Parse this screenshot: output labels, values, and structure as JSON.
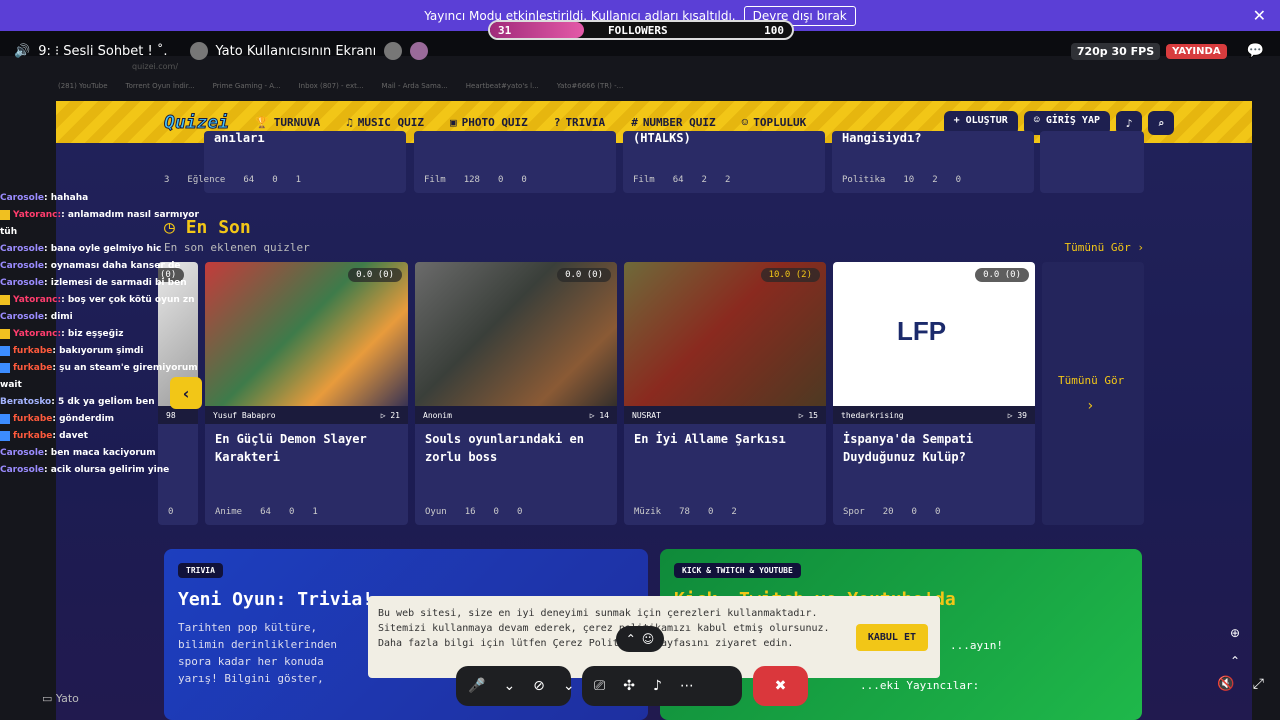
{
  "banner": {
    "text": "Yayıncı Modu etkinleştirildi. Kullanıcı adları kısaltıldı.",
    "disable_button": "Devre dışı bırak",
    "followers": {
      "current": "31",
      "label": "FOLLOWERS",
      "goal": "100",
      "progress_fraction": 0.31
    }
  },
  "topbar": {
    "channel": "9: ⁝ Sesli Sohbet ! ˚.",
    "stream_title": "Yato Kullanıcısının Ekranı",
    "quality": "720p 30 FPS",
    "live_label": "YAYINDA"
  },
  "browser": {
    "url": "quizei.com/",
    "tabs": [
      "(281) YouTube",
      "Torrent Oyun İndir...",
      "Prime Gaming - A...",
      "Inbox (807) - ext...",
      "Mail - Arda Sama...",
      "Heartbeat#yato's l...",
      "Yato#6666 (TR) -..."
    ]
  },
  "site": {
    "logo": "Quizei",
    "nav": [
      "TURNUVA",
      "MUSIC QUIZ",
      "PHOTO QUIZ",
      "TRIVIA",
      "NUMBER QUIZ",
      "TOPLULUK"
    ],
    "create": "+ OLUŞTUR",
    "login": "GİRİŞ YAP",
    "prev_row": [
      {
        "title": "anıları",
        "category": "Eğlence",
        "questions": "64",
        "comments": "0",
        "likes": "1",
        "extra": "3"
      },
      {
        "title": "",
        "category": "Film",
        "questions": "128",
        "comments": "0",
        "likes": "0"
      },
      {
        "title": "(HTALKS)",
        "category": "Film",
        "questions": "64",
        "comments": "2",
        "likes": "2"
      },
      {
        "title": "Hangisiydı?",
        "category": "Politika",
        "questions": "10",
        "comments": "2",
        "likes": "0"
      }
    ],
    "section": {
      "title": "En Son",
      "subtitle": "En son eklenen quizler",
      "see_all": "Tümünü Gör ›",
      "see_all_card": "Tümünü Gör"
    },
    "cards": [
      {
        "rating": "0.0 (0)",
        "author": "Yusuf Babapro",
        "plays": "21",
        "title": "En Güçlü Demon Slayer Karakteri",
        "category": "Anime",
        "questions": "64",
        "comments": "0",
        "likes": "1"
      },
      {
        "rating": "0.0 (0)",
        "author": "Anonim",
        "plays": "14",
        "title": "Souls oyunlarındaki en zorlu boss",
        "category": "Oyun",
        "questions": "16",
        "comments": "0",
        "likes": "0"
      },
      {
        "rating": "10.0 (2)",
        "author": "NUSRAT",
        "plays": "15",
        "title": "En İyi Allame Şarkısı",
        "category": "Müzik",
        "questions": "78",
        "comments": "0",
        "likes": "2"
      },
      {
        "rating": "0.0 (0)",
        "author": "thedarkrising",
        "plays": "39",
        "title": "İspanya'da Sempati Duyduğunuz Kulüp?",
        "category": "Spor",
        "questions": "20",
        "comments": "0",
        "likes": "0"
      }
    ],
    "first_card_left": {
      "rating": "(0)",
      "plays": "98",
      "likes": "0"
    },
    "promo_left": {
      "tag": "TRIVIA",
      "title": "Yeni Oyun: Trivia!",
      "text": "Tarihten pop kültüre, bilimin derinliklerinden spora kadar her konuda yarış! Bilgini göster,"
    },
    "promo_right": {
      "tag": "KICK & TWITCH & YOUTUBE",
      "title": "Kick, Twitch ve Youtube'da",
      "text": "...ayın!",
      "footer": "...eki Yayıncılar:"
    },
    "cookie": {
      "text": "Bu web sitesi, size en iyi deneyimi sunmak için çerezleri kullanmaktadır. Sitemizi kullanmaya devam ederek, çerez politikamızı kabul etmiş olursunuz. Daha fazla bilgi için lütfen Çerez Politikası sayfasını ziyaret edin.",
      "accept": "KABUL ET"
    }
  },
  "chat": [
    {
      "user": "Carosole",
      "msg": ": hahaha",
      "style": "u1",
      "badge": ""
    },
    {
      "user": "Yatoranc:",
      "msg": ": anlamadım nasıl sarmıyor tüh",
      "style": "u2",
      "badge": "y"
    },
    {
      "user": "Carosole",
      "msg": ": bana oyle gelmiyo hic",
      "style": "u1",
      "badge": ""
    },
    {
      "user": "Carosole",
      "msg": ": oynaması daha kanser de",
      "style": "u1",
      "badge": ""
    },
    {
      "user": "Carosole",
      "msg": ": izlemesi de sarmadi bi ben",
      "style": "u1",
      "badge": ""
    },
    {
      "user": "Yatoranc:",
      "msg": ": boş ver çok kötü oyun zn",
      "style": "u2",
      "badge": "y"
    },
    {
      "user": "Carosole",
      "msg": ": dimi",
      "style": "u1",
      "badge": ""
    },
    {
      "user": "Yatoranc:",
      "msg": ": biz eşşeğiz",
      "style": "u2",
      "badge": "y"
    },
    {
      "user": "furkabe",
      "msg": ": bakıyorum şimdi",
      "style": "u3",
      "badge": "b"
    },
    {
      "user": "furkabe",
      "msg": ": şu an steam'e giremiyorum wait",
      "style": "u3",
      "badge": "b"
    },
    {
      "user": "Beratosko",
      "msg": ": 5 dk ya gelİom ben",
      "style": "u4",
      "badge": ""
    },
    {
      "user": "furkabe",
      "msg": ": gönderdim",
      "style": "u3",
      "badge": "b"
    },
    {
      "user": "furkabe",
      "msg": ": davet",
      "style": "u3",
      "badge": "b"
    },
    {
      "user": "Carosole",
      "msg": ": ben maca kaciyorum",
      "style": "u1",
      "badge": ""
    },
    {
      "user": "Carosole",
      "msg": ": acik olursa gelirim yine",
      "style": "u1",
      "badge": ""
    }
  ],
  "footer": {
    "streamer": "Yato"
  }
}
